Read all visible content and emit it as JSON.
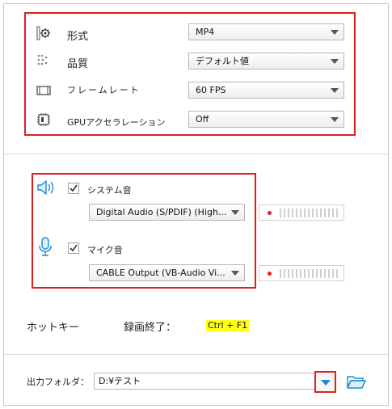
{
  "video_settings": {
    "format": {
      "label": "形式",
      "value": "MP4",
      "icon": "gear-icon"
    },
    "quality": {
      "label": "品質",
      "value": "デフォルト値",
      "icon": "dots-grid-icon"
    },
    "framerate": {
      "label": "フレームレート",
      "value": "60 FPS",
      "icon": "film-strip-icon"
    },
    "gpu": {
      "label": "GPUアクセラレーション",
      "value": "Off",
      "icon": "chip-icon"
    }
  },
  "audio": {
    "system": {
      "label": "システム音",
      "checked": true,
      "device": "Digital Audio (S/PDIF) (High...",
      "icon": "speaker-icon"
    },
    "mic": {
      "label": "マイク音",
      "checked": true,
      "device": "CABLE Output (VB-Audio Vi...",
      "icon": "microphone-icon"
    }
  },
  "hotkey": {
    "label": "ホットキー",
    "action": "録画終了：",
    "keys": "Ctrl + F1"
  },
  "output": {
    "label": "出力フォルダ：",
    "path": "D:¥テスト",
    "browse_icon": "folder-icon",
    "dropdown_icon": "chevron-down-icon"
  },
  "colors": {
    "highlight_box": "#e01e1e",
    "accent": "#1a8ad4",
    "hotkey_bg": "#ffff1a"
  }
}
